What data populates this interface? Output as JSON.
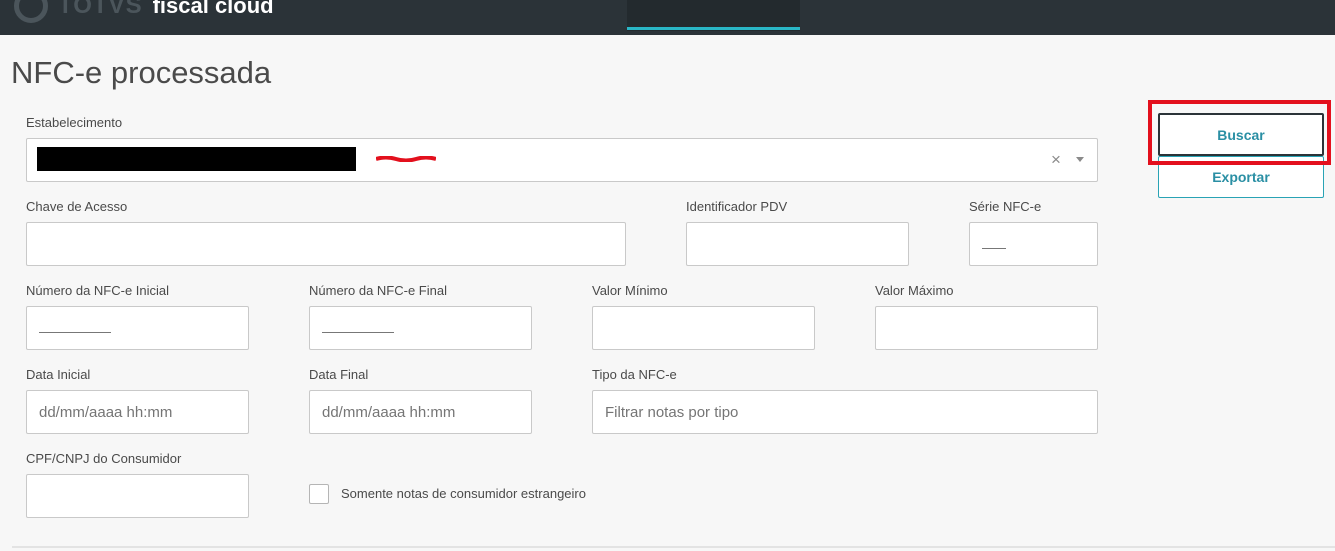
{
  "app": {
    "brand_word": "TOTVS",
    "product_name": "fiscal cloud"
  },
  "page": {
    "title": "NFC-e processada"
  },
  "form": {
    "estabelecimento": {
      "label": "Estabelecimento",
      "clear_glyph": "×"
    },
    "chave_acesso": {
      "label": "Chave de Acesso",
      "value": ""
    },
    "identificador_pdv": {
      "label": "Identificador PDV",
      "value": ""
    },
    "serie": {
      "label": "Série NFC-e"
    },
    "numero_inicial": {
      "label": "Número da NFC-e Inicial"
    },
    "numero_final": {
      "label": "Número da NFC-e Final"
    },
    "valor_minimo": {
      "label": "Valor Mínimo",
      "value": ""
    },
    "valor_maximo": {
      "label": "Valor Máximo",
      "value": ""
    },
    "data_inicial": {
      "label": "Data Inicial",
      "placeholder": "dd/mm/aaaa hh:mm"
    },
    "data_final": {
      "label": "Data Final",
      "placeholder": "dd/mm/aaaa hh:mm"
    },
    "tipo": {
      "label": "Tipo da NFC-e",
      "placeholder": "Filtrar notas por tipo"
    },
    "cpf_cnpj": {
      "label": "CPF/CNPJ do Consumidor",
      "value": ""
    },
    "estrangeiro": {
      "label": "Somente notas de consumidor estrangeiro",
      "checked": false
    }
  },
  "actions": {
    "buscar_label": "Buscar",
    "exportar_label": "Exportar"
  },
  "colors": {
    "topbar": "#2b3338",
    "accent": "#29b6c6",
    "button_text": "#2a8fa4",
    "highlight": "#e3101d"
  }
}
